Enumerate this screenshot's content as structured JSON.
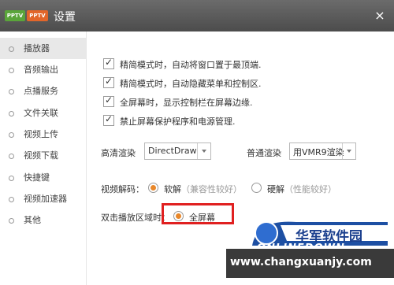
{
  "window": {
    "title": "设置",
    "logo_left": "PPTV",
    "logo_right": "PPTV",
    "close_glyph": "×"
  },
  "sidebar": {
    "items": [
      {
        "label": "播放器",
        "active": true
      },
      {
        "label": "音频输出"
      },
      {
        "label": "点播服务"
      },
      {
        "label": "文件关联"
      },
      {
        "label": "视频上传"
      },
      {
        "label": "视频下载"
      },
      {
        "label": "快捷键"
      },
      {
        "label": "视频加速器"
      },
      {
        "label": "其他"
      }
    ]
  },
  "options": [
    {
      "label": "精简模式时，自动将窗口置于最顶端.",
      "checked": true
    },
    {
      "label": "精简模式时，自动隐藏菜单和控制区.",
      "checked": true
    },
    {
      "label": "全屏幕时，显示控制栏在屏幕边缘.",
      "checked": true
    },
    {
      "label": "禁止屏幕保护程序和电源管理.",
      "checked": true
    }
  ],
  "render": {
    "hd_label": "高清渲染",
    "hd_value": "DirectDraw",
    "normal_label": "普通渲染",
    "normal_value": "用VMR9渲染"
  },
  "decode": {
    "label": "视频解码：",
    "soft_label": "软解",
    "soft_note": "（兼容性较好）",
    "hard_label": "硬解",
    "hard_note": "（性能较好）",
    "selected": "soft"
  },
  "dblclick": {
    "label": "双击播放区域时：",
    "fullscreen_label": "全屏幕"
  },
  "watermark": {
    "cn": "华军软件园",
    "en": "ONLINEDOWN",
    "url": "www.changxuanjy.com"
  },
  "colors": {
    "accent": "#e8872a",
    "highlight": "#e02020",
    "titlebar": "#555555"
  }
}
